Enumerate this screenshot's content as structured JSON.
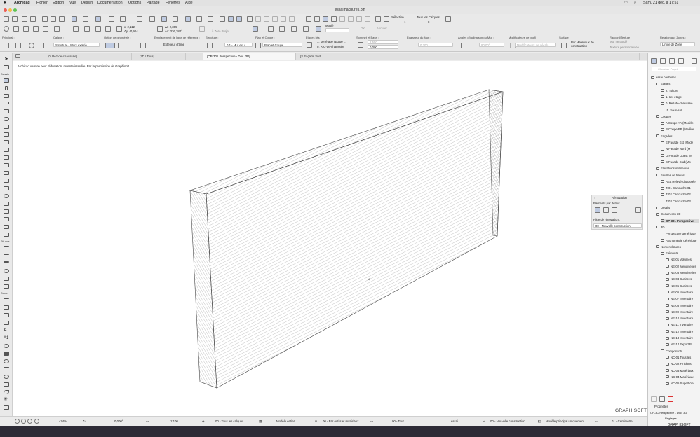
{
  "menubar": {
    "app": "Archicad",
    "items": [
      "Fichier",
      "Edition",
      "Vue",
      "Dessin",
      "Documentation",
      "Options",
      "Partage",
      "Fenêtres",
      "Aide"
    ],
    "datetime": "Sam. 21 déc. à 17:51"
  },
  "window": {
    "title": "essai hachures.pln"
  },
  "toolbar": {
    "half_label": "Moitié",
    "selection_label": "Sélection :",
    "selection_count": "1",
    "all_layers": "Tous les Calques",
    "all_layers_count": "8",
    "ok_label": "OK",
    "cancel_label": "Annuler",
    "coord_x": "2,112",
    "coord_y": "-0,924",
    "coord_dx": "2,305",
    "coord_angle": "336,384°",
    "zero_project": "à Zéro Projet"
  },
  "infobox": {
    "fields": [
      {
        "label": "Principal :",
        "value": ""
      },
      {
        "label": "Calque :",
        "value": "Structure - Murs extérie..."
      },
      {
        "label": "Option de géométrie :",
        "value": ""
      },
      {
        "label": "Emplacement de ligne de référence :",
        "value": "Extérieur d'âme"
      },
      {
        "label": "Structure :",
        "value": "0.1 - Mur ext /..."
      },
      {
        "label": "Plan et Coupe :",
        "value": "Plan et Coupe..."
      },
      {
        "label": "Etages liés :",
        "value": "1. 1er étage (Etage ...",
        "value2": "0. Rez-de-chaussée"
      },
      {
        "label": "Sommet et Base :",
        "value": "2,550",
        "value2": "0,000"
      },
      {
        "label": "Epaisseur du Mur :",
        "value": "0,200"
      },
      {
        "label": "Angles d'Inclinaison du Mur :",
        "value": "90,00°"
      },
      {
        "label": "Modificateurs de profil :",
        "value": "Modificateurs de décala..."
      },
      {
        "label": "Surface :",
        "value": "Par Matériaux de construction"
      },
      {
        "label": "Raccord/Texture :",
        "value": "Mur raccordé",
        "value2": "Texture personnalisée"
      },
      {
        "label": "Relation aux Zones :",
        "value": "Limite de Zone"
      }
    ]
  },
  "tabs": [
    {
      "label": "[0. Rez-de-chaussée]"
    },
    {
      "label": "[3D / Tous]"
    },
    {
      "label": "[OP-301 Perspective - Doc. 3D]"
    },
    {
      "label": "[S Façade Sud]"
    }
  ],
  "toolbox": {
    "sections": [
      "Dessin",
      "Pt. vue",
      "Docu."
    ]
  },
  "canvas": {
    "notice": "Archicad version pour l'éducation, revente interdite. Par la permission de Graphisoft."
  },
  "renovation": {
    "title": "Rénovation",
    "default_elements": "Éléments par défaut :",
    "filter_label": "Filtre de rénovation :",
    "filter_value": "00 - Nouvelle construction"
  },
  "navigator": {
    "search_placeholder": "Chercher Projet",
    "items": [
      {
        "label": "essai hachures",
        "level": 0
      },
      {
        "label": "Etages",
        "level": 1
      },
      {
        "label": "2. Toiture",
        "level": 2
      },
      {
        "label": "1. 1er étage",
        "level": 2
      },
      {
        "label": "0. Rez-de-chaussée",
        "level": 2
      },
      {
        "label": "-1. Sous-sol",
        "level": 2
      },
      {
        "label": "Coupes",
        "level": 1
      },
      {
        "label": "A Coupe AA (Modèle",
        "level": 2
      },
      {
        "label": "B Coupe BB (Modèle",
        "level": 2
      },
      {
        "label": "Façades",
        "level": 1
      },
      {
        "label": "E Façade Est (Modè",
        "level": 2
      },
      {
        "label": "N Façade Nord (M",
        "level": 2
      },
      {
        "label": "O Façade Ouest (M",
        "level": 2
      },
      {
        "label": "S Façade Sud (Mo",
        "level": 2
      },
      {
        "label": "Elévations intérieures",
        "level": 1
      },
      {
        "label": "Feuilles de travail",
        "level": 1
      },
      {
        "label": "REL Relevé-chaussée",
        "level": 2
      },
      {
        "label": "Z-01 Cartouche 01",
        "level": 2
      },
      {
        "label": "Z-02 Cartouche 02",
        "level": 2
      },
      {
        "label": "Z-03 Cartouche 03",
        "level": 2
      },
      {
        "label": "Détails",
        "level": 1
      },
      {
        "label": "Documents 3D",
        "level": 1
      },
      {
        "label": "OP-301 Perspective",
        "level": 2,
        "selected": true
      },
      {
        "label": "3D",
        "level": 1
      },
      {
        "label": "Perspective générique",
        "level": 2
      },
      {
        "label": "Axonométrie générique",
        "level": 2
      },
      {
        "label": "Nomenclatures",
        "level": 1
      },
      {
        "label": "Eléments",
        "level": 2
      },
      {
        "label": "NE-01 Volumes",
        "level": 3
      },
      {
        "label": "NE-02 Menuiseries",
        "level": 3
      },
      {
        "label": "NE-03 Menuiseries",
        "level": 3
      },
      {
        "label": "NE-04 Surfaces",
        "level": 3
      },
      {
        "label": "NE-05 Surfaces",
        "level": 3
      },
      {
        "label": "NE-06 Inventaire",
        "level": 3
      },
      {
        "label": "NE-07 Inventaire",
        "level": 3
      },
      {
        "label": "NE-08 Inventaire",
        "level": 3
      },
      {
        "label": "NE-09 Inventaire",
        "level": 3
      },
      {
        "label": "NE-10 Inventaire",
        "level": 3
      },
      {
        "label": "NE-11 Inventaire",
        "level": 3
      },
      {
        "label": "NE-12 Inventaire",
        "level": 3
      },
      {
        "label": "NE-13 Inventaire",
        "level": 3
      },
      {
        "label": "NE-14 Export BI",
        "level": 3
      },
      {
        "label": "Composants",
        "level": 2
      },
      {
        "label": "NC-01 Tous les",
        "level": 3
      },
      {
        "label": "NC-02 Finitions",
        "level": 3
      },
      {
        "label": "NC-03 Matériaux",
        "level": 3
      },
      {
        "label": "NC-04 Matériaux",
        "level": 3
      },
      {
        "label": "NC-05 Superficie",
        "level": 3
      }
    ],
    "properties_label": "Propriétés",
    "properties_value": "OP-3C Perspective - Doc. 3D",
    "settings_label": "Réglages..."
  },
  "statusbar": {
    "zoom": "474%",
    "angle": "0,000°",
    "scale": "1:100",
    "layers": "00 - Tous les calques",
    "model": "Modèle entier",
    "pens": "00 - Par outils et matériaux",
    "all": "00 - Tout",
    "project": "essai",
    "renovation": "00 - Nouvelle construction",
    "main_model": "Modèle principal uniquement",
    "dimension": "01 - Centimètre"
  },
  "brand": {
    "name": "GRAPHISOFT"
  }
}
